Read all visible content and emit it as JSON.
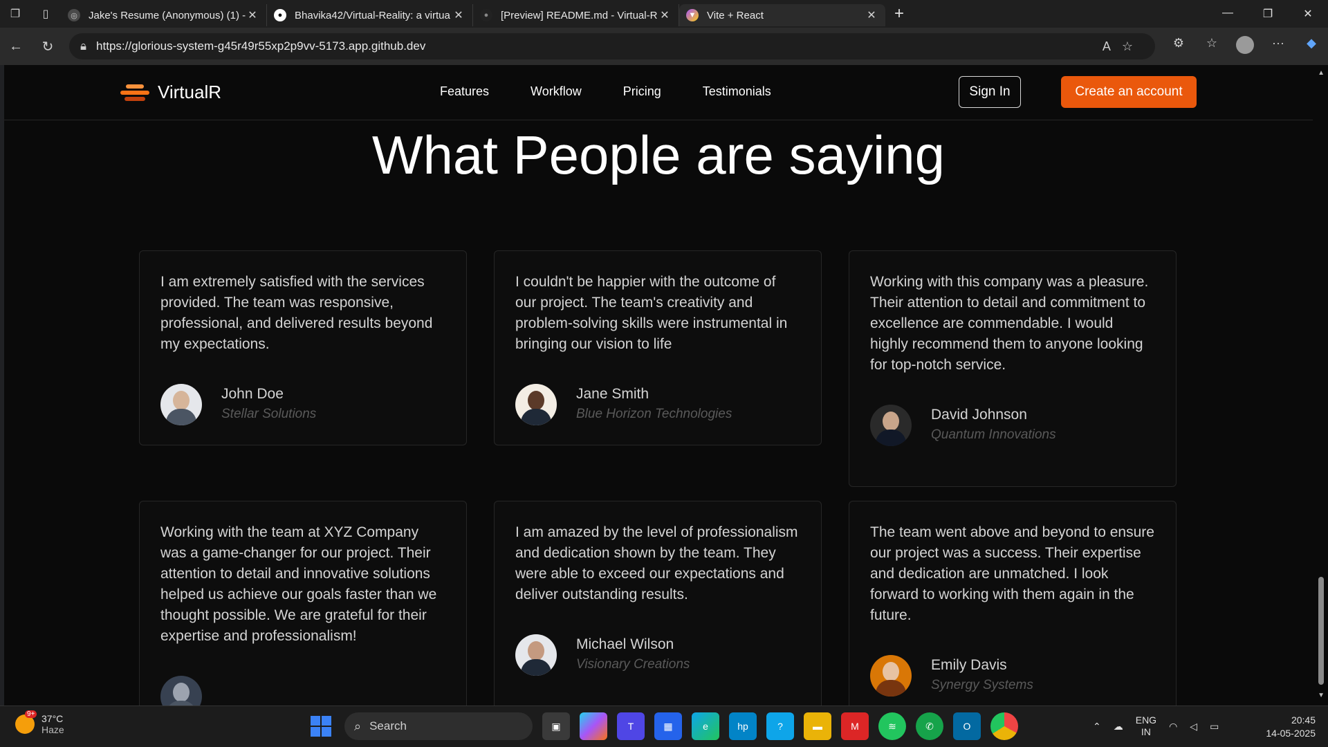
{
  "browser": {
    "tabs": [
      {
        "title": "Jake's Resume (Anonymous) (1) -",
        "favicon": "overleaf-icon"
      },
      {
        "title": "Bhavika42/Virtual-Reality: a virtua",
        "favicon": "github-icon"
      },
      {
        "title": "[Preview] README.md - Virtual-R",
        "favicon": "github-icon"
      },
      {
        "title": "Vite + React",
        "favicon": "vite-icon"
      }
    ],
    "url": "https://glorious-system-g45r49r55xp2p9vv-5173.app.github.dev"
  },
  "site": {
    "brand": "VirtualR",
    "nav": [
      "Features",
      "Workflow",
      "Pricing",
      "Testimonials"
    ],
    "sign_in": "Sign In",
    "create_account": "Create an account",
    "accent": "#ea580c",
    "heading": "What People are saying",
    "testimonials": [
      {
        "text": "I am extremely satisfied with the services provided. The team was responsive, professional, and delivered results beyond my expectations.",
        "name": "John Doe",
        "company": "Stellar Solutions"
      },
      {
        "text": "I couldn't be happier with the outcome of our project. The team's creativity and problem-solving skills were instrumental in bringing our vision to life",
        "name": "Jane Smith",
        "company": "Blue Horizon Technologies"
      },
      {
        "text": "Working with this company was a pleasure. Their attention to detail and commitment to excellence are commendable. I would highly recommend them to anyone looking for top-notch service.",
        "name": "David Johnson",
        "company": "Quantum Innovations"
      },
      {
        "text": "Working with the team at XYZ Company was a game-changer for our project. Their attention to detail and innovative solutions helped us achieve our goals faster than we thought possible. We are grateful for their expertise and professionalism!",
        "name": "",
        "company": ""
      },
      {
        "text": "I am amazed by the level of professionalism and dedication shown by the team. They were able to exceed our expectations and deliver outstanding results.",
        "name": "Michael Wilson",
        "company": "Visionary Creations"
      },
      {
        "text": "The team went above and beyond to ensure our project was a success. Their expertise and dedication are unmatched. I look forward to working with them again in the future.",
        "name": "Emily Davis",
        "company": "Synergy Systems"
      }
    ]
  },
  "taskbar": {
    "weather_badge": "9+",
    "temperature": "37°C",
    "condition": "Haze",
    "search_placeholder": "Search",
    "lang_top": "ENG",
    "lang_bottom": "IN",
    "time": "20:45",
    "date": "14-05-2025"
  }
}
